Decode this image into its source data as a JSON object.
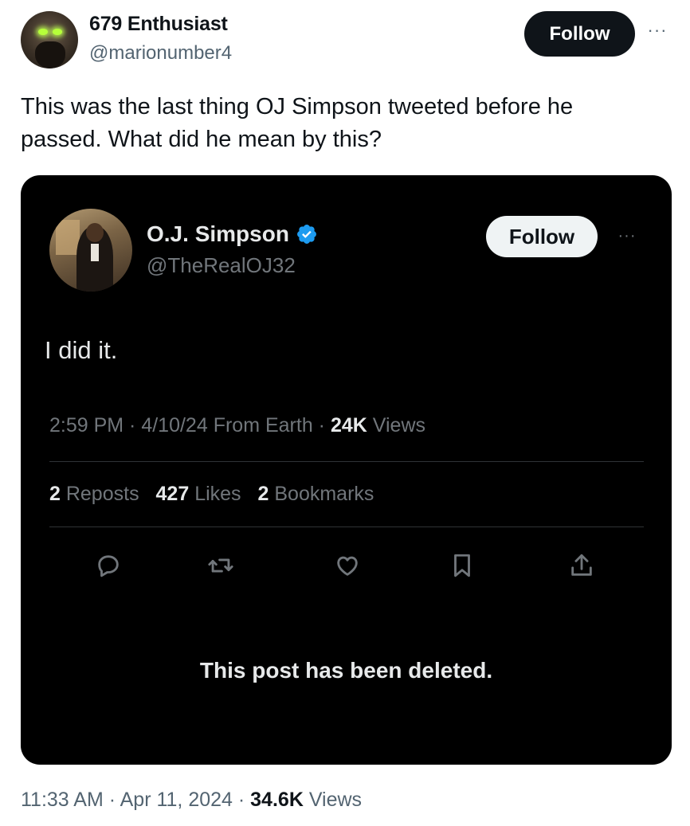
{
  "author": {
    "display_name": "679 Enthusiast",
    "handle": "@marionumber4",
    "follow_label": "Follow",
    "more_label": "···"
  },
  "tweet": {
    "text": "This was the last thing OJ Simpson tweeted before he passed. What did he mean by this?"
  },
  "embedded": {
    "display_name": "O.J. Simpson",
    "handle": "@TheRealOJ32",
    "follow_label": "Follow",
    "more_label": "···",
    "text": "I did it.",
    "meta": {
      "time": "2:59 PM",
      "sep1": " · ",
      "date": "4/10/24",
      "source": " From Earth",
      "sep2": " · ",
      "views_count": "24K",
      "views_label": " Views"
    },
    "stats": {
      "reposts_count": "2",
      "reposts_label": " Reposts",
      "likes_count": "427",
      "likes_label": " Likes",
      "bookmarks_count": "2",
      "bookmarks_label": " Bookmarks"
    },
    "deleted_note": "This post has been deleted."
  },
  "footer": {
    "time": "11:33 AM",
    "sep1": " · ",
    "date": "Apr 11, 2024",
    "sep2": " · ",
    "views_count": "34.6K",
    "views_label": " Views"
  },
  "colors": {
    "verified_blue": "#1d9bf0",
    "card_bg": "#000000",
    "muted_gray": "#71767b"
  },
  "icons": [
    "reply-icon",
    "repost-icon",
    "like-icon",
    "bookmark-icon",
    "share-icon",
    "verified-badge-icon"
  ]
}
